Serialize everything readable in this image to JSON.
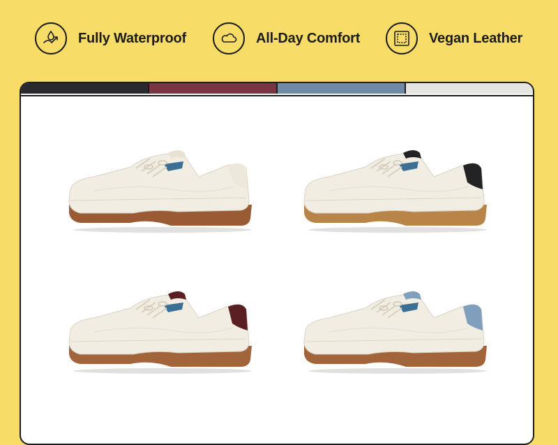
{
  "features": [
    {
      "label": "Fully Waterproof",
      "icon": "waterproof-icon"
    },
    {
      "label": "All-Day Comfort",
      "icon": "cloud-icon"
    },
    {
      "label": "Vegan Leather",
      "icon": "stitched-square-icon"
    }
  ],
  "colors": {
    "background": "#f7dc68",
    "swatches": [
      "#2a2a2e",
      "#7b3444",
      "#6f8aa4",
      "#e6e4e0"
    ]
  },
  "shoes": [
    {
      "name": "shoe-white-blue",
      "heel": "#ece8dc",
      "accent": "#3d6f94",
      "sole": "#9a5a34"
    },
    {
      "name": "shoe-white-black",
      "heel": "#232325",
      "accent": "#3d6f94",
      "sole": "#b98448"
    },
    {
      "name": "shoe-white-burgundy",
      "heel": "#5a1f22",
      "accent": "#3d6f94",
      "sole": "#a2643b"
    },
    {
      "name": "shoe-white-lightblue",
      "heel": "#7f9fbd",
      "accent": "#3d6f94",
      "sole": "#a2643b"
    }
  ]
}
